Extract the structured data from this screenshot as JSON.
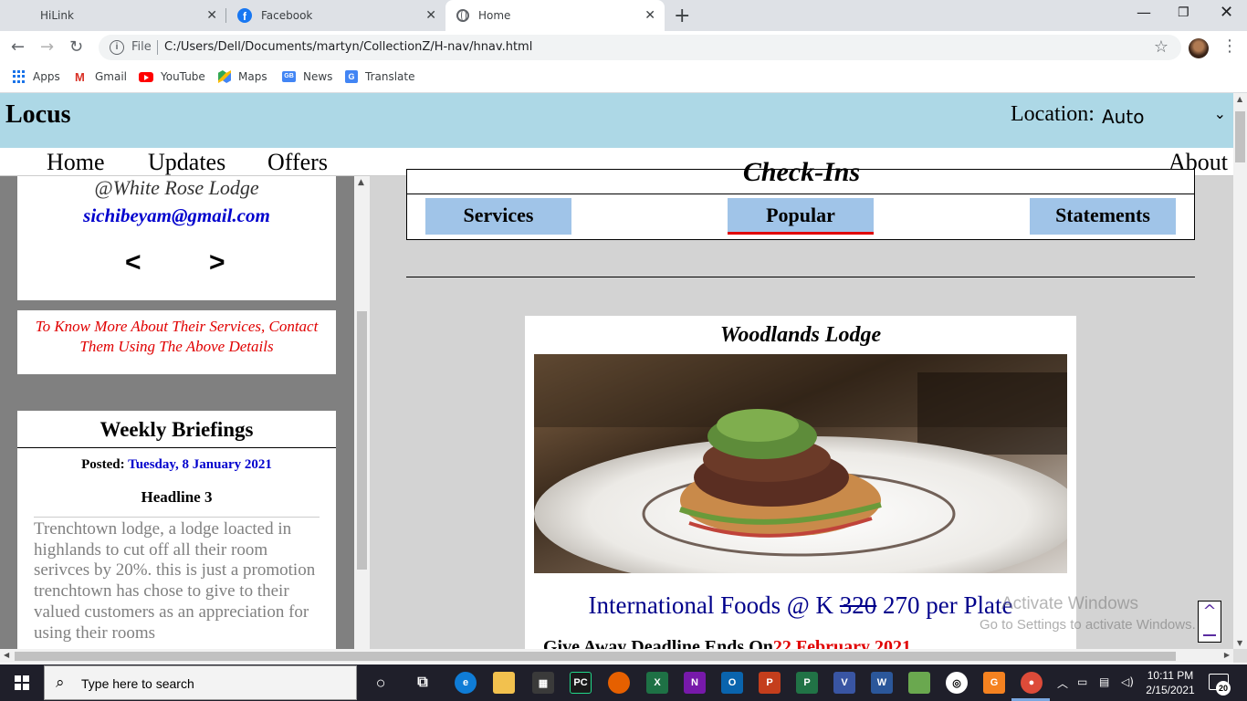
{
  "browser": {
    "tabs": [
      {
        "label": "HiLink"
      },
      {
        "label": "Facebook"
      },
      {
        "label": "Home"
      }
    ],
    "address": {
      "scheme_label": "File",
      "url": "C:/Users/Dell/Documents/martyn/CollectionZ/H-nav/hnav.html"
    },
    "bookmarks": [
      {
        "label": "Apps"
      },
      {
        "label": "Gmail"
      },
      {
        "label": "YouTube"
      },
      {
        "label": "Maps"
      },
      {
        "label": "News"
      },
      {
        "label": "Translate"
      }
    ]
  },
  "site": {
    "logo": "Locus",
    "location_label": "Location:",
    "location_value": "Auto",
    "nav": {
      "home": "Home",
      "updates": "Updates",
      "offers": "Offers",
      "about": "About"
    }
  },
  "sidebar": {
    "contact": {
      "lodge": "@White Rose Lodge",
      "email": "sichibeyam@gmail.com",
      "prev": "<",
      "next": ">"
    },
    "notice": "To Know More About Their Services, Contact Them Using The Above Details",
    "briefings": {
      "title": "Weekly Briefings",
      "posted_label": "Posted:",
      "posted_date": "Tuesday, 8 January 2021",
      "headline": "Headline 3",
      "body": "Trenchtown lodge, a lodge loacted in highlands to cut off all their room serivces by 20%. this is just a promotion trenchtown has chose to give to their valued customers as an appreciation for using their rooms"
    }
  },
  "main": {
    "section_title": "Check-Ins",
    "tabs": {
      "services": "Services",
      "popular": "Popular",
      "statements": "Statements"
    },
    "active_tab": "Popular",
    "card": {
      "name": "Woodlands Lodge",
      "offer_prefix": "International Foods @ K",
      "old_price": "320",
      "new_price_suffix": "270 per Plate",
      "deadline_label": "Give Away Deadline Ends On",
      "deadline_date": "22 February 2021"
    }
  },
  "overlay": {
    "watermark_title": "Activate Windows",
    "watermark_sub": "Go to Settings to activate Windows.",
    "to_top": "^"
  },
  "taskbar": {
    "search_placeholder": "Type here to search",
    "time": "10:11 PM",
    "date": "2/15/2021",
    "notifications": "20"
  },
  "colors": {
    "header_bg": "#add8e6",
    "tab_bg": "#a0c4e8",
    "accent_red": "#e00000",
    "email_blue": "#0000cd",
    "offer_navy": "#00008b"
  }
}
